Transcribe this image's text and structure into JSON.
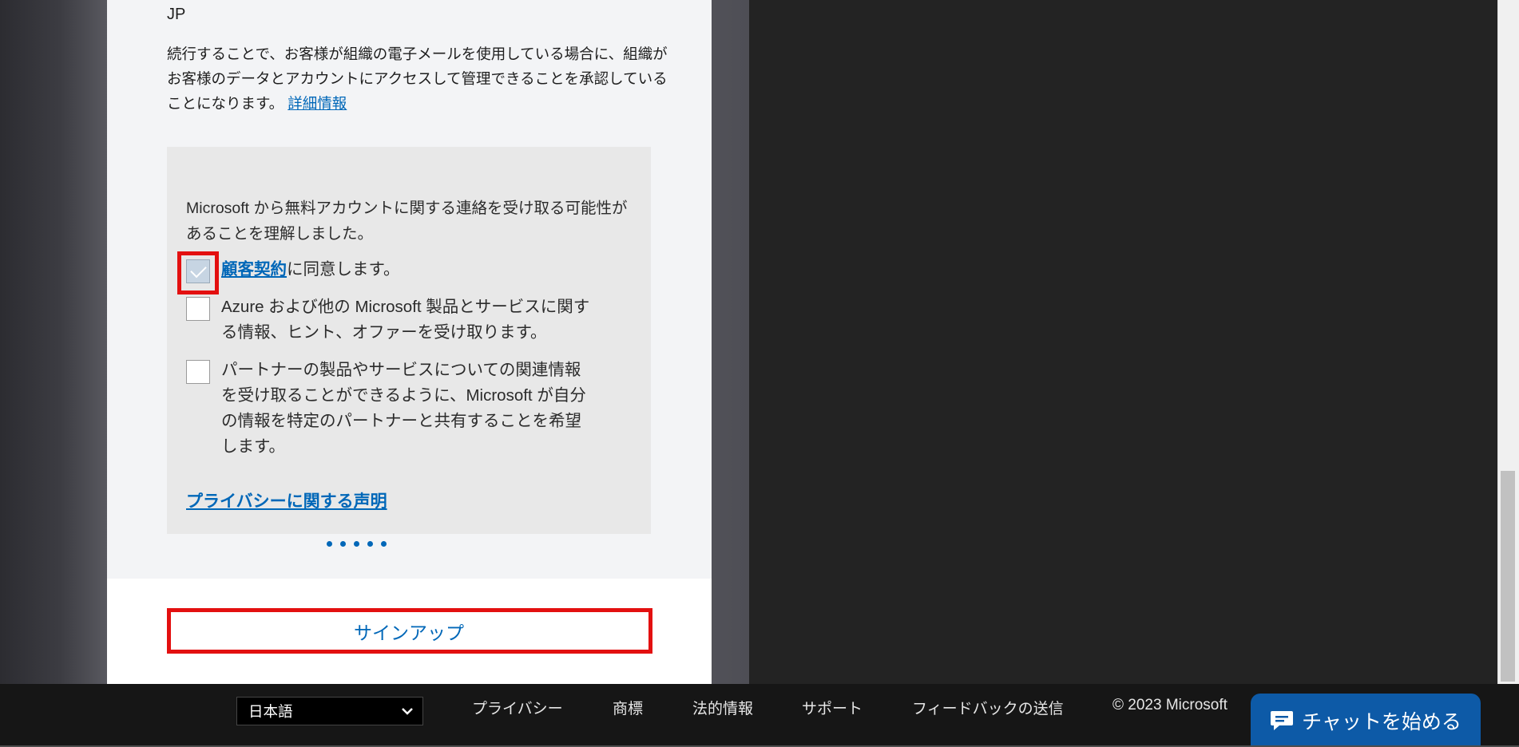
{
  "form": {
    "region": "JP",
    "consent_text": "続行することで、お客様が組織の電子メールを使用している場合に、組織がお客様のデータとアカウントにアクセスして管理できることを承認していることになります。",
    "learn_more": "詳細情報",
    "notice": "Microsoft から無料アカウントに関する連絡を受け取る可能性があることを理解しました。",
    "agreement_link": "顧客契約",
    "agreement_suffix": "に同意します。",
    "marketing_text": "Azure および他の Microsoft 製品とサービスに関する情報、ヒント、オファーを受け取ります。",
    "partner_text": "パートナーの製品やサービスについての関連情報を受け取ることができるように、Microsoft が自分の情報を特定のパートナーと共有することを希望します。",
    "privacy_link": "プライバシーに関する声明",
    "signup_button": "サインアップ"
  },
  "checkboxes": {
    "agreement_checked": true,
    "marketing_checked": false,
    "partner_checked": false
  },
  "footer": {
    "language": "日本語",
    "links": [
      "プライバシー",
      "商標",
      "法的情報",
      "サポート",
      "フィードバックの送信"
    ],
    "copyright": "© 2023 Microsoft",
    "chat_button": "チャットを始める"
  },
  "colors": {
    "link": "#0067b8",
    "highlight": "#e31010",
    "chat": "#0d5aa7"
  },
  "icons": [
    "checkmark-icon",
    "chevron-down-icon",
    "chat-bubble-icon"
  ]
}
